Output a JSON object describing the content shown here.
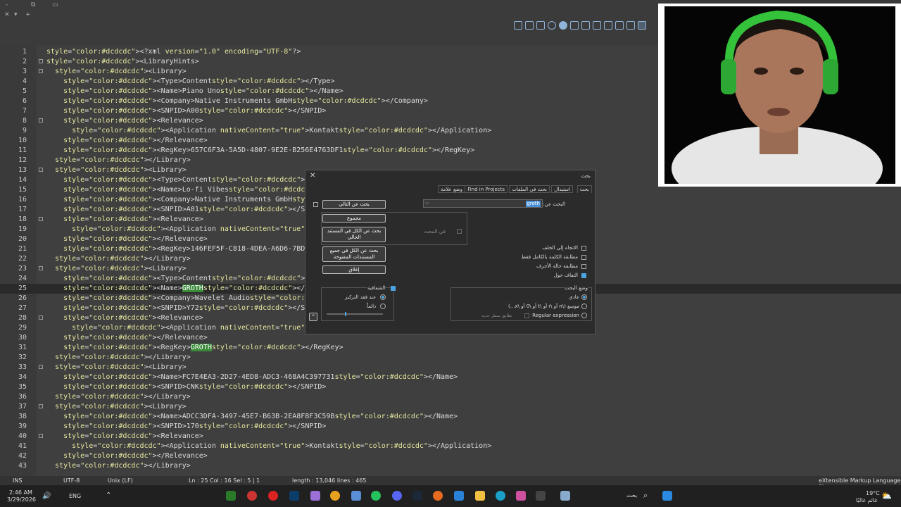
{
  "window": {
    "controls": [
      "-",
      "⧉",
      "▭"
    ],
    "tab_controls": [
      "✕",
      "▾",
      "+"
    ]
  },
  "editor_lines": [
    {
      "n": "1",
      "text": "<?xml version=\"1.0\" encoding=\"UTF-8\"?>"
    },
    {
      "n": "2",
      "text": "<LibraryHints>",
      "fold": true
    },
    {
      "n": "3",
      "text": "  <Library>",
      "fold": true
    },
    {
      "n": "4",
      "text": "    <Type>Content</Type>"
    },
    {
      "n": "5",
      "text": "    <Name>Piano Uno</Name>"
    },
    {
      "n": "6",
      "text": "    <Company>Native Instruments GmbH</Company>"
    },
    {
      "n": "7",
      "text": "    <SNPID>A00</SNPID>"
    },
    {
      "n": "8",
      "text": "    <Relevance>",
      "fold": true
    },
    {
      "n": "9",
      "text": "      <Application nativeContent=\"true\">Kontakt</Application>"
    },
    {
      "n": "10",
      "text": "    </Relevance>"
    },
    {
      "n": "11",
      "text": "    <RegKey>657C6F3A-5A5D-4807-9E2E-B256E4763DF1</RegKey>"
    },
    {
      "n": "12",
      "text": "  </Library>"
    },
    {
      "n": "13",
      "text": "  <Library>",
      "fold": true
    },
    {
      "n": "14",
      "text": "    <Type>Content</Type>"
    },
    {
      "n": "15",
      "text": "    <Name>Lo-fi Vibes</Name>"
    },
    {
      "n": "16",
      "text": "    <Company>Native Instruments GmbH</Company>"
    },
    {
      "n": "17",
      "text": "    <SNPID>A01</SNPID>"
    },
    {
      "n": "18",
      "text": "    <Relevance>",
      "fold": true
    },
    {
      "n": "19",
      "text": "      <Application nativeContent=\"true\">Kontakt</Applicatio"
    },
    {
      "n": "20",
      "text": "    </Relevance>"
    },
    {
      "n": "21",
      "text": "    <RegKey>146FEF5F-C818-4DEA-A6D6-7BD5B5CFE54A</RegKey>"
    },
    {
      "n": "22",
      "text": "  </Library>"
    },
    {
      "n": "23",
      "text": "  <Library>",
      "fold": true
    },
    {
      "n": "24",
      "text": "    <Type>Content</Type>"
    },
    {
      "n": "25",
      "text": "    <Name>GROTH</Name>",
      "current": true
    },
    {
      "n": "26",
      "text": "    <Company>Wavelet Audio</Company>"
    },
    {
      "n": "27",
      "text": "    <SNPID>Y72</SNPID>"
    },
    {
      "n": "28",
      "text": "    <Relevance>",
      "fold": true
    },
    {
      "n": "29",
      "text": "      <Application nativeContent=\"true\">Kontakt</Applicatio"
    },
    {
      "n": "30",
      "text": "    </Relevance>"
    },
    {
      "n": "31",
      "text": "    <RegKey>GROTH</RegKey>"
    },
    {
      "n": "32",
      "text": "  </Library>"
    },
    {
      "n": "33",
      "text": "  <Library>",
      "fold": true
    },
    {
      "n": "34",
      "text": "    <Name>FC7E4EA3-2D27-4ED8-ADC3-468A4C397731</Name>"
    },
    {
      "n": "35",
      "text": "    <SNPID>CNK</SNPID>"
    },
    {
      "n": "36",
      "text": "  </Library>"
    },
    {
      "n": "37",
      "text": "  <Library>",
      "fold": true
    },
    {
      "n": "38",
      "text": "    <Name>ADCC3DFA-3497-45E7-B63B-2EA8F8F3C59B</Name>"
    },
    {
      "n": "39",
      "text": "    <SNPID>170</SNPID>"
    },
    {
      "n": "40",
      "text": "    <Relevance>",
      "fold": true
    },
    {
      "n": "41",
      "text": "      <Application nativeContent=\"true\">Kontakt</Application>"
    },
    {
      "n": "42",
      "text": "    </Relevance>"
    },
    {
      "n": "43",
      "text": "  </Library>"
    }
  ],
  "search_dialog": {
    "title": "بحث",
    "tabs": [
      "بحث",
      "استبدال",
      "بحث في الملفات",
      "Find in Projects",
      "وضع علامة"
    ],
    "search_label": "البحث عن:",
    "search_value": "groth",
    "find_next": "بحث عن التالي",
    "count": "مجموع",
    "find_all_current": "بحث عن الكل في المستند الحالي",
    "find_all_open": "بحث عن الكل في جميع المستندات المفتوحة",
    "close_btn": "إغلاق",
    "in_selection": "في المحدد",
    "backward": "الاتجاه إلى الخلف",
    "whole_word": "مطابقة الكلمة بالكامل فقط",
    "match_case": "مطابقة حالة الأحرف",
    "wrap": "التفاف حول",
    "transparency": "الشفافية",
    "on_lose_focus": "عند فقد التركيز",
    "always": "دائماً",
    "search_mode": "وضع البحث",
    "mode_normal": "عادي",
    "mode_extended": "موسع (\\n أو \\r أو \\t أو \\0 أو \\x...)",
    "mode_regex": "Regular expression",
    "dot_newline": "تطابق سطر جديد",
    "collapse": "^"
  },
  "status_bar": {
    "ins": "INS",
    "encoding": "UTF-8",
    "eol": "Unix (LF)",
    "position": "Ln : 25    Col : 16    Sel : 5 | 1",
    "length": "length : 13,046    lines : 465",
    "language": "eXtensible Markup Language file"
  },
  "taskbar": {
    "time": "2:46 AM",
    "date": "3/29/2026",
    "lang": "ENG",
    "search_placeholder": "بحث",
    "temp": "19°C",
    "weather": "غائم غالبًا"
  },
  "colors": {
    "accent": "#4aa3df",
    "highlight": "#3a8a3a",
    "headset": "#34c23a"
  }
}
